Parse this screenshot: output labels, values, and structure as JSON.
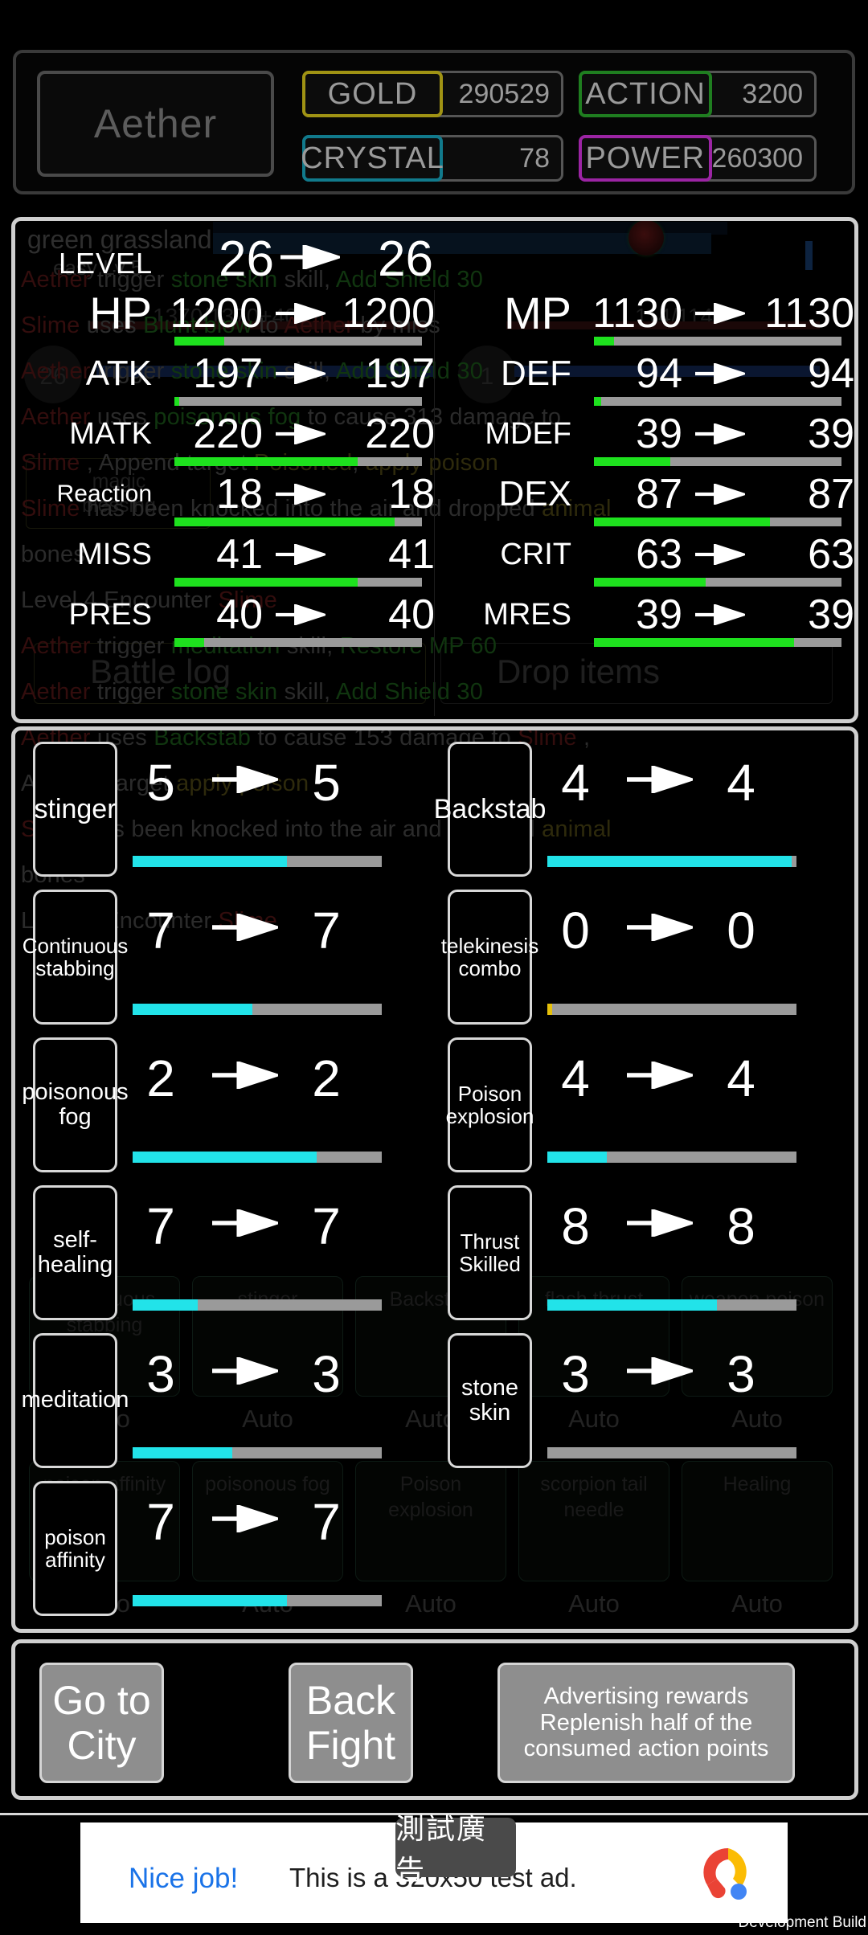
{
  "header": {
    "player_name": "Aether",
    "resources": [
      {
        "key": "gold",
        "label": "GOLD",
        "value": "290529",
        "color": "#a09314"
      },
      {
        "key": "crystal",
        "label": "CRYSTAL",
        "value": "78",
        "color": "#117a8c"
      },
      {
        "key": "action",
        "label": "ACTION",
        "value": "3200",
        "color": "#1f7e20"
      },
      {
        "key": "power",
        "label": "POWER",
        "value": "260300",
        "color": "#9b24a3"
      }
    ]
  },
  "stats": {
    "level": {
      "label": "LEVEL",
      "from": "26",
      "to": "26"
    },
    "left": [
      {
        "label": "HP",
        "from": "1200",
        "to": "1200",
        "fill": 20
      },
      {
        "label": "ATK",
        "from": "197",
        "to": "197",
        "fill": 2
      },
      {
        "label": "MATK",
        "from": "220",
        "to": "220",
        "fill": 74
      },
      {
        "label": "Reaction",
        "from": "18",
        "to": "18",
        "fill": 89
      },
      {
        "label": "MISS",
        "from": "41",
        "to": "41",
        "fill": 74
      },
      {
        "label": "PRES",
        "from": "40",
        "to": "40",
        "fill": 12
      }
    ],
    "right": [
      {
        "label": "MP",
        "from": "1130",
        "to": "1130",
        "fill": 8
      },
      {
        "label": "DEF",
        "from": "94",
        "to": "94",
        "fill": 3
      },
      {
        "label": "MDEF",
        "from": "39",
        "to": "39",
        "fill": 31
      },
      {
        "label": "DEX",
        "from": "87",
        "to": "87",
        "fill": 71
      },
      {
        "label": "CRIT",
        "from": "63",
        "to": "63",
        "fill": 45
      },
      {
        "label": "MRES",
        "from": "39",
        "to": "39",
        "fill": 81
      }
    ]
  },
  "skills": [
    {
      "name": "stinger",
      "from": "5",
      "to": "5",
      "fill": 62,
      "color": "cyan"
    },
    {
      "name": "Backstab",
      "from": "4",
      "to": "4",
      "fill": 98,
      "color": "cyan"
    },
    {
      "name": "Continuous stabbing",
      "from": "7",
      "to": "7",
      "fill": 48,
      "color": "cyan"
    },
    {
      "name": "telekinesis combo",
      "from": "0",
      "to": "0",
      "fill": 2,
      "color": "amber"
    },
    {
      "name": "poisonous fog",
      "from": "2",
      "to": "2",
      "fill": 74,
      "color": "cyan"
    },
    {
      "name": "Poison explosion",
      "from": "4",
      "to": "4",
      "fill": 24,
      "color": "cyan"
    },
    {
      "name": "self-healing",
      "from": "7",
      "to": "7",
      "fill": 26,
      "color": "cyan"
    },
    {
      "name": "Thrust Skilled",
      "from": "8",
      "to": "8",
      "fill": 68,
      "color": "cyan"
    },
    {
      "name": "meditation",
      "from": "3",
      "to": "3",
      "fill": 40,
      "color": "cyan"
    },
    {
      "name": "stone skin",
      "from": "3",
      "to": "3",
      "fill": 0,
      "color": "cyan"
    },
    {
      "name": "poison affinity",
      "from": "7",
      "to": "7",
      "fill": 62,
      "color": "cyan"
    }
  ],
  "buttons": {
    "go_to_city": "Go to City",
    "back_fight": "Back Fight",
    "ad_reward": "Advertising rewards Replenish half of the consumed action points"
  },
  "ad": {
    "badge": "測試廣告",
    "cta": "Nice job!",
    "text": "This is a 320x50 test ad.",
    "watermark": "Development Build"
  },
  "background": {
    "area_name": "green grassland",
    "area_difficulty": "easy Lv 5",
    "hp_text": "1370/1370+40",
    "mp_text": "114/114",
    "enemy_name": "Slime",
    "player_level": "26",
    "enemy_level": "1",
    "tab_battle_log": "Battle log",
    "tab_drop_items": "Drop items",
    "log_lines": [
      "Aether  trigger stone skin skill, Add Shield 30",
      "Slime  uses Blunt blow to Aether  by miss",
      "Aether  trigger stone skin skill, Add Shield 30",
      "Aether  uses poisonous fog to cause 313 damage to",
      "Slime , Append target Poisoned, apply poison",
      "Slime  has been knocked into the air and dropped animal",
      "bones",
      "Level 4 Encounter Slime",
      "Aether  trigger meditation skill, Restore MP 60",
      "Aether  trigger stone skin skill, Add Shield 30",
      "Aether  uses Backstab to cause 153 damage to Slime ,",
      "Append target apply poison",
      "Slime  has been knocked into the air and dropped animal",
      "bones",
      "Level 5 Encounter Slime"
    ],
    "skill_cards": [
      "Continuous stabbing",
      "stinger",
      "Backstab",
      "flash thrust",
      "weapon poison",
      "poison affinity",
      "poisonous fog",
      "Poison explosion",
      "scorpion tail needle",
      "Healing"
    ],
    "auto_label": "Auto"
  }
}
